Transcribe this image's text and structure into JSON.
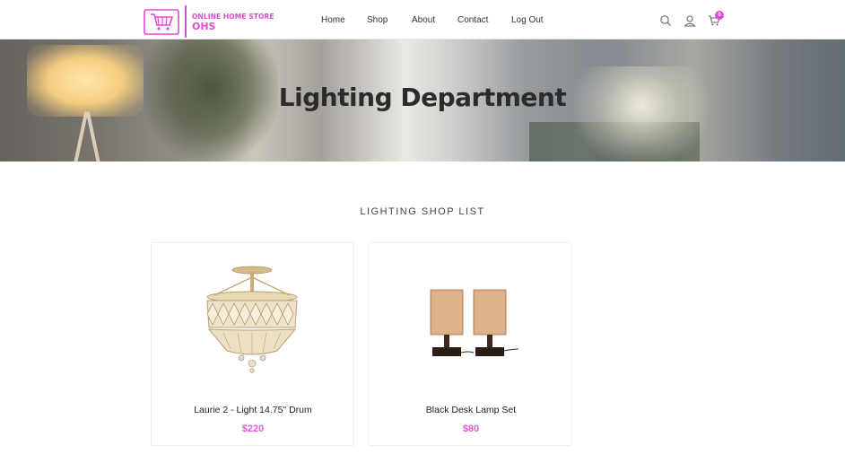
{
  "brand": {
    "line1": "ONLINE HOME STORE",
    "line2": "OHS"
  },
  "nav": {
    "items": [
      {
        "label": "Home"
      },
      {
        "label": "Shop"
      },
      {
        "label": "About"
      },
      {
        "label": "Contact"
      },
      {
        "label": "Log Out"
      }
    ]
  },
  "header_icons": {
    "search": "search-icon",
    "user": "user-icon",
    "cart": "cart-icon",
    "cart_count": "0"
  },
  "hero": {
    "title": "Lighting Department"
  },
  "section": {
    "title": "LIGHTING SHOP LIST"
  },
  "products": [
    {
      "name": "Laurie 2 - Light 14.75\" Drum",
      "price": "$220"
    },
    {
      "name": "Black Desk Lamp Set",
      "price": "$80"
    }
  ],
  "colors": {
    "accent": "#e448d6",
    "price": "#e85ad6",
    "text": "#333333"
  }
}
